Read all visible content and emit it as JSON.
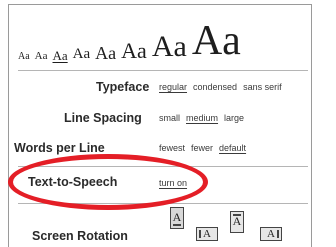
{
  "font_sizes": {
    "label": "Aa",
    "count": 8,
    "selected_index": 2
  },
  "typeface": {
    "label": "Typeface",
    "options": [
      "regular",
      "condensed",
      "sans serif"
    ],
    "selected": "regular"
  },
  "line_spacing": {
    "label": "Line Spacing",
    "options": [
      "small",
      "medium",
      "large"
    ],
    "selected": "medium"
  },
  "words_per_line": {
    "label": "Words per Line",
    "options": [
      "fewest",
      "fewer",
      "default"
    ],
    "selected": "default"
  },
  "text_to_speech": {
    "label": "Text-to-Speech",
    "options": [
      "turn on"
    ],
    "selected": "turn on"
  },
  "screen_rotation": {
    "label": "Screen Rotation",
    "icon_letter": "A",
    "icons": [
      "portrait-up-icon",
      "landscape-left-icon",
      "portrait-down-icon",
      "landscape-right-icon"
    ],
    "selected_index": 0
  },
  "annotation": {
    "highlight_color": "#e41e26"
  }
}
